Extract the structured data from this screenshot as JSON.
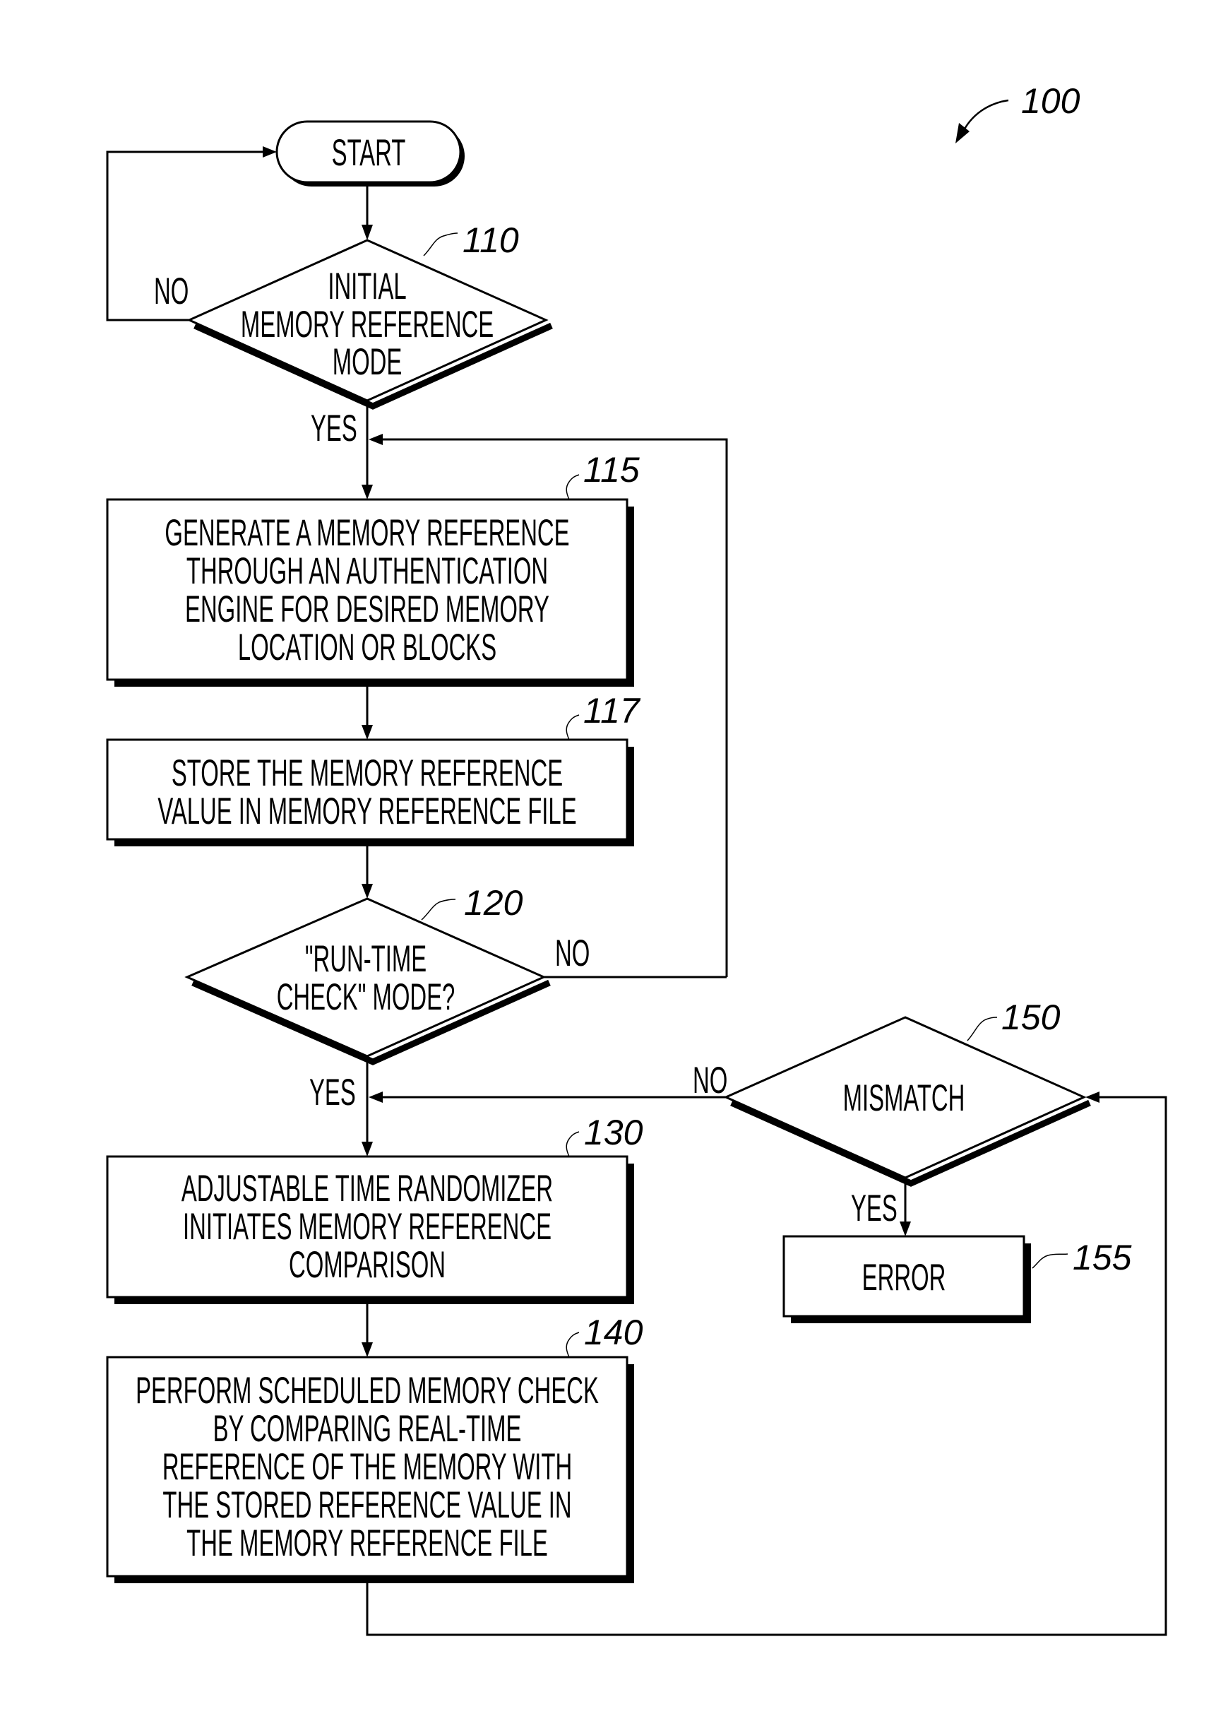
{
  "figure": {
    "reference_numeral": "100",
    "nodes": {
      "start": {
        "label": "START"
      },
      "initial_mode": {
        "ref": "110",
        "lines": [
          "INITIAL",
          "MEMORY REFERENCE",
          "MODE"
        ],
        "no_label": "NO",
        "yes_label": "YES"
      },
      "generate_reference": {
        "ref": "115",
        "lines": [
          "GENERATE A MEMORY REFERENCE",
          "THROUGH AN AUTHENTICATION",
          "ENGINE FOR DESIRED MEMORY",
          "LOCATION OR BLOCKS"
        ]
      },
      "store_reference": {
        "ref": "117",
        "lines": [
          "STORE THE MEMORY REFERENCE",
          "VALUE IN MEMORY REFERENCE FILE"
        ]
      },
      "runtime_check": {
        "ref": "120",
        "lines": [
          "\"RUN-TIME",
          "CHECK\" MODE?"
        ],
        "no_label": "NO",
        "yes_label": "YES"
      },
      "time_randomizer": {
        "ref": "130",
        "lines": [
          "ADJUSTABLE TIME RANDOMIZER",
          "INITIATES MEMORY REFERENCE",
          "COMPARISON"
        ]
      },
      "scheduled_check": {
        "ref": "140",
        "lines": [
          "PERFORM SCHEDULED MEMORY CHECK",
          "BY COMPARING REAL-TIME",
          "REFERENCE OF THE MEMORY WITH",
          "THE STORED REFERENCE VALUE IN",
          "THE MEMORY REFERENCE FILE"
        ]
      },
      "mismatch": {
        "ref": "150",
        "label": "MISMATCH",
        "no_label": "NO",
        "yes_label": "YES"
      },
      "error": {
        "ref": "155",
        "label": "ERROR"
      }
    }
  }
}
